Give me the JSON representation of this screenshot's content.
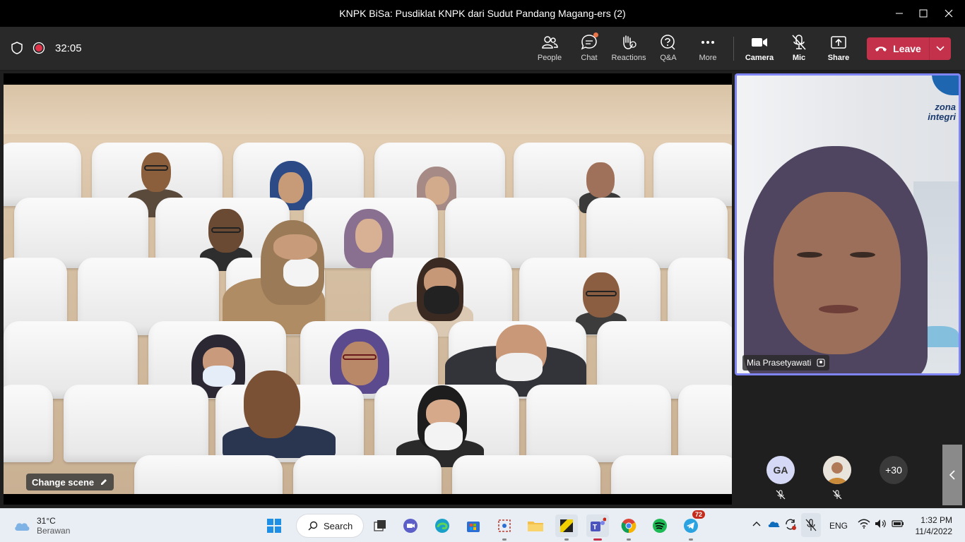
{
  "window": {
    "title": "KNPK BiSa: Pusdiklat KNPK dari Sudut Pandang Magang-ers (2)"
  },
  "toolbar": {
    "timer": "32:05",
    "items": [
      {
        "label": "People",
        "icon": "people-icon"
      },
      {
        "label": "Chat",
        "icon": "chat-icon"
      },
      {
        "label": "Reactions",
        "icon": "reactions-icon"
      },
      {
        "label": "Q&A",
        "icon": "qa-icon"
      },
      {
        "label": "More",
        "icon": "more-icon"
      }
    ],
    "controls": [
      {
        "label": "Camera",
        "icon": "camera-icon"
      },
      {
        "label": "Mic",
        "icon": "mic-off-icon"
      },
      {
        "label": "Share",
        "icon": "share-icon"
      }
    ],
    "leave_label": "Leave",
    "leave_color": "#c4314b"
  },
  "stage": {
    "change_scene_label": "Change scene"
  },
  "pinned": {
    "name": "Mia Prasetyawati",
    "logo_line1": "zona",
    "logo_line2": "integri"
  },
  "side_participants": {
    "initials": "GA",
    "overflow": "+30"
  },
  "taskbar": {
    "weather_temp": "31°C",
    "weather_desc": "Berawan",
    "search_label": "Search",
    "telegram_badge": "72",
    "language": "ENG",
    "time": "1:32 PM",
    "date": "11/4/2022"
  }
}
